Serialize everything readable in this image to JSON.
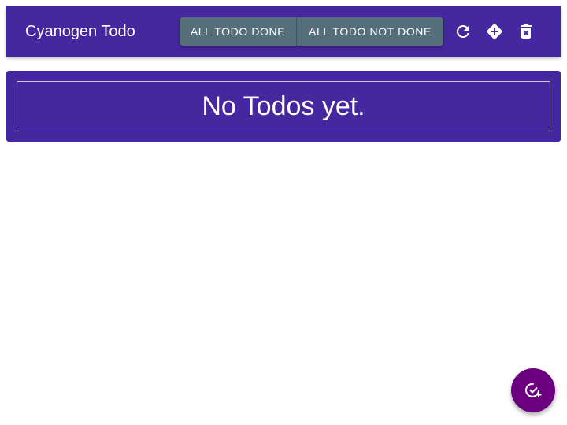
{
  "header": {
    "title": "Cyanogen Todo",
    "buttons": {
      "all_done_label": "ALL TODO DONE",
      "all_not_done_label": "ALL TODO NOT DONE"
    },
    "icons": [
      "refresh-icon",
      "directions-icon",
      "delete-forever-icon"
    ]
  },
  "main": {
    "empty_message": "No Todos yet."
  },
  "fab": {
    "icon": "add-task-icon"
  },
  "colors": {
    "primary": "#4527a0",
    "button": "#546e7a",
    "fab": "#6a0080",
    "text": "#ffffff"
  }
}
